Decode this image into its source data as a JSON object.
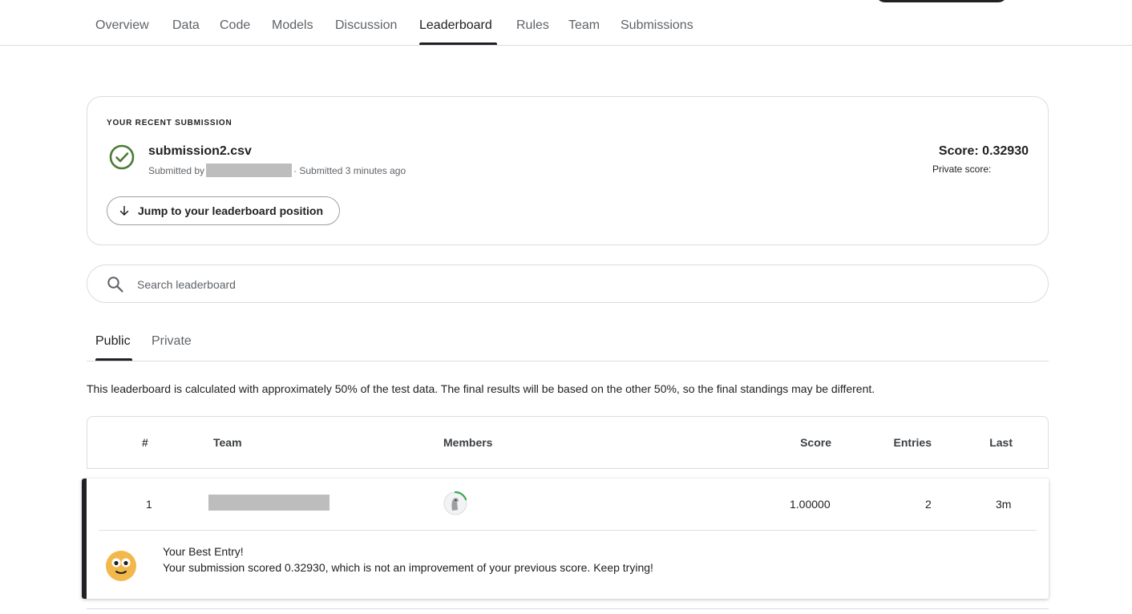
{
  "nav": {
    "tabs": [
      "Overview",
      "Data",
      "Code",
      "Models",
      "Discussion",
      "Leaderboard",
      "Rules",
      "Team",
      "Submissions"
    ],
    "active": "Leaderboard"
  },
  "recent": {
    "kicker": "YOUR RECENT SUBMISSION",
    "filename": "submission2.csv",
    "submitted_by_label": "Submitted by",
    "submitted_time": "· Submitted 3 minutes ago",
    "score": "Score: 0.32930",
    "private_score": "Private score:",
    "jump_label": "Jump to your leaderboard position"
  },
  "search": {
    "placeholder": "Search leaderboard"
  },
  "subtabs": {
    "public": "Public",
    "private": "Private",
    "active": "Public"
  },
  "note": "This leaderboard is calculated with approximately 50% of the test data. The final results will be based on the other 50%, so the final standings may be different.",
  "table": {
    "headers": {
      "rank": "#",
      "team": "Team",
      "members": "Members",
      "score": "Score",
      "entries": "Entries",
      "last": "Last"
    },
    "rows": [
      {
        "rank": "1",
        "score": "1.00000",
        "entries": "2",
        "last": "3m"
      }
    ]
  },
  "best_entry": {
    "title": "Your Best Entry!",
    "message": "Your submission scored 0.32930, which is not an improvement of your previous score. Keep trying!"
  },
  "colors": {
    "success": "#4b7b34",
    "text": "#202124",
    "muted": "#5f6368",
    "border": "#dadce0",
    "redaction": "#bdbdbd"
  },
  "icons": [
    "check-circle-icon",
    "arrow-down-icon",
    "search-icon",
    "avatar-icon",
    "emoji-icon"
  ]
}
